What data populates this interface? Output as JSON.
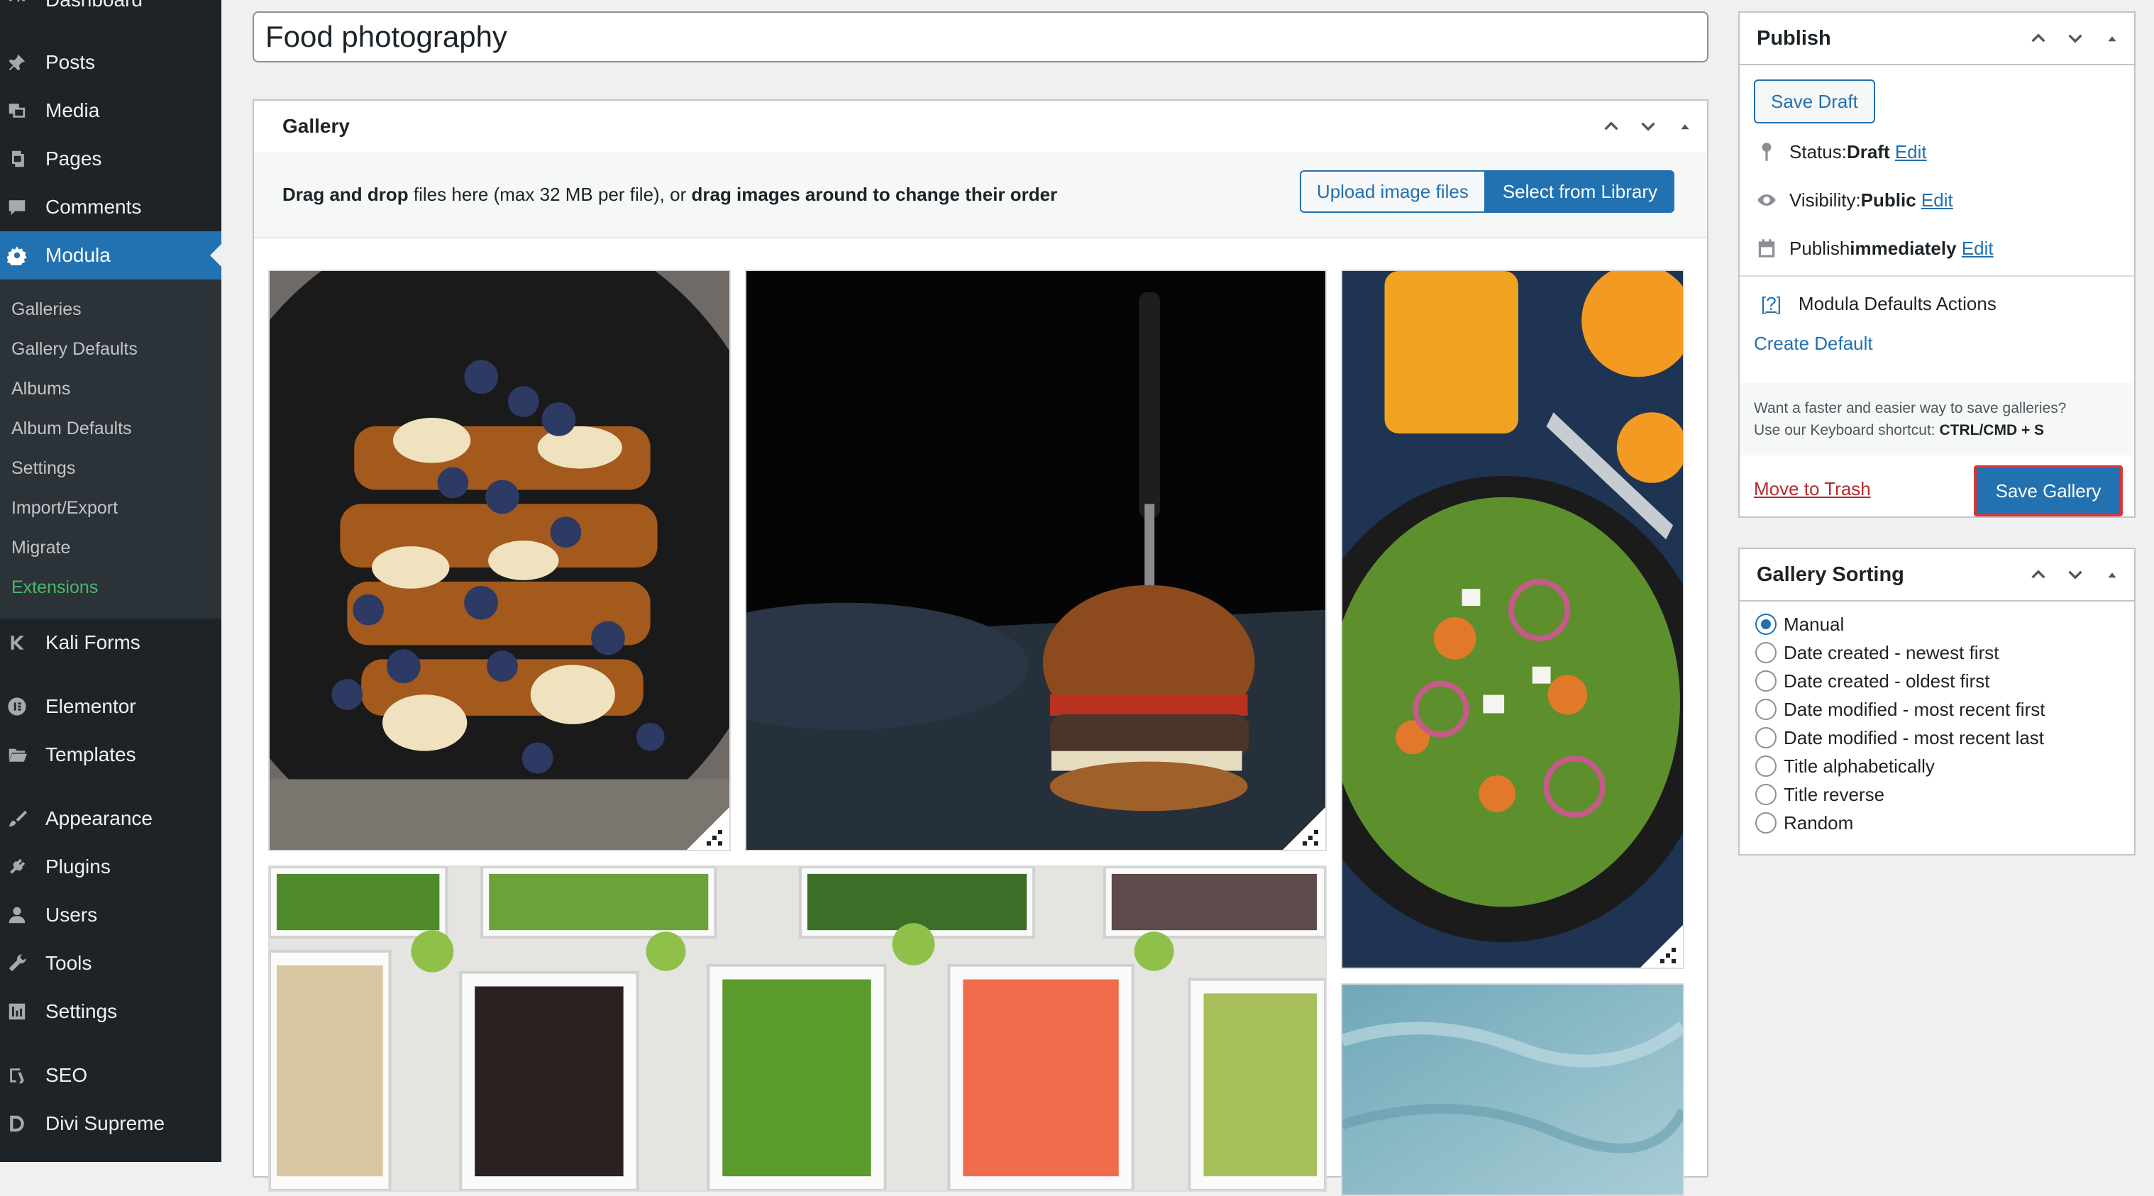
{
  "sidebar": {
    "items": [
      {
        "label": "Dashboard",
        "icon": "dashboard-icon"
      },
      {
        "label": "Posts",
        "icon": "pin-icon"
      },
      {
        "label": "Media",
        "icon": "media-icon"
      },
      {
        "label": "Pages",
        "icon": "pages-icon"
      },
      {
        "label": "Comments",
        "icon": "comment-icon"
      },
      {
        "label": "Modula",
        "icon": "modula-gear-icon"
      },
      {
        "label": "Kali Forms",
        "icon": "kali-forms-icon"
      },
      {
        "label": "Elementor",
        "icon": "elementor-icon"
      },
      {
        "label": "Templates",
        "icon": "folder-icon"
      },
      {
        "label": "Appearance",
        "icon": "brush-icon"
      },
      {
        "label": "Plugins",
        "icon": "plug-icon"
      },
      {
        "label": "Users",
        "icon": "user-icon"
      },
      {
        "label": "Tools",
        "icon": "wrench-icon"
      },
      {
        "label": "Settings",
        "icon": "settings-icon"
      },
      {
        "label": "SEO",
        "icon": "seo-icon"
      },
      {
        "label": "Divi Supreme",
        "icon": "divi-icon"
      }
    ],
    "submenu": [
      "Galleries",
      "Gallery Defaults",
      "Albums",
      "Album Defaults",
      "Settings",
      "Import/Export",
      "Migrate",
      "Extensions"
    ]
  },
  "post": {
    "title": "Food photography"
  },
  "gallery_box": {
    "title": "Gallery",
    "upload_help": {
      "part1": "Drag and drop",
      "part2": " files here (max 32 MB per file), or ",
      "part3": "drag images around to change their order"
    },
    "upload_button": "Upload image files",
    "library_button": "Select from Library",
    "images": [
      "french-toast-photo",
      "burger-photo",
      "salad-photo",
      "vegetable-bowls-photo",
      "blue-texture-photo"
    ]
  },
  "publish_box": {
    "title": "Publish",
    "save_draft": "Save Draft",
    "status_label": "Status: ",
    "status_value": "Draft",
    "visibility_label": "Visibility: ",
    "visibility_value": "Public",
    "publish_label": "Publish ",
    "publish_value": "immediately",
    "edit": "Edit",
    "defaults_help": "[?]",
    "defaults_label": "Modula Defaults Actions",
    "create_default": "Create Default",
    "kbd_line1": "Want a faster and easier way to save galleries?",
    "kbd_line2": "Use our Keyboard shortcut: ",
    "kbd_shortcut": "CTRL/CMD + S",
    "move_to_trash": "Move to Trash",
    "save_gallery": "Save Gallery"
  },
  "sorting_box": {
    "title": "Gallery Sorting",
    "options": [
      "Manual",
      "Date created - newest first",
      "Date created - oldest first",
      "Date modified - most recent first",
      "Date modified - most recent last",
      "Title alphabetically",
      "Title reverse",
      "Random"
    ],
    "selected": "Manual"
  },
  "colors": {
    "admin_bar": "#1d2327",
    "submenu_bg": "#2c3338",
    "accent": "#2271b1",
    "extensions_green": "#4ab866",
    "trash_red": "#b32d2e"
  }
}
